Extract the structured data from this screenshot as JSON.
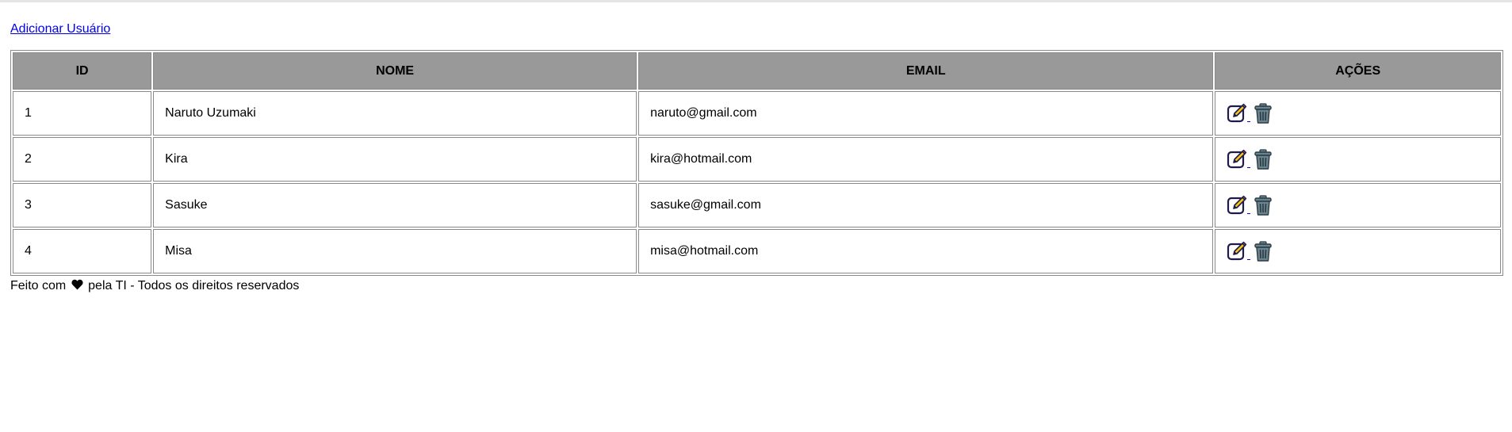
{
  "header": {
    "add_user_link": "Adicionar Usuário"
  },
  "table": {
    "columns": [
      "ID",
      "NOME",
      "EMAIL",
      "AÇÕES"
    ],
    "rows": [
      {
        "id": "1",
        "nome": "Naruto Uzumaki",
        "email": "naruto@gmail.com"
      },
      {
        "id": "2",
        "nome": "Kira",
        "email": "kira@hotmail.com"
      },
      {
        "id": "3",
        "nome": "Sasuke",
        "email": "sasuke@gmail.com"
      },
      {
        "id": "4",
        "nome": "Misa",
        "email": "misa@hotmail.com"
      }
    ],
    "actions": [
      "edit-icon",
      "trash-icon"
    ]
  },
  "footer": {
    "prefix": "Feito com",
    "heart_icon": "heart-icon",
    "suffix": "pela TI - Todos os direitos reservados"
  },
  "colors": {
    "header_bg": "#999999",
    "border": "#8a8a8a",
    "link": "#0000ee"
  }
}
